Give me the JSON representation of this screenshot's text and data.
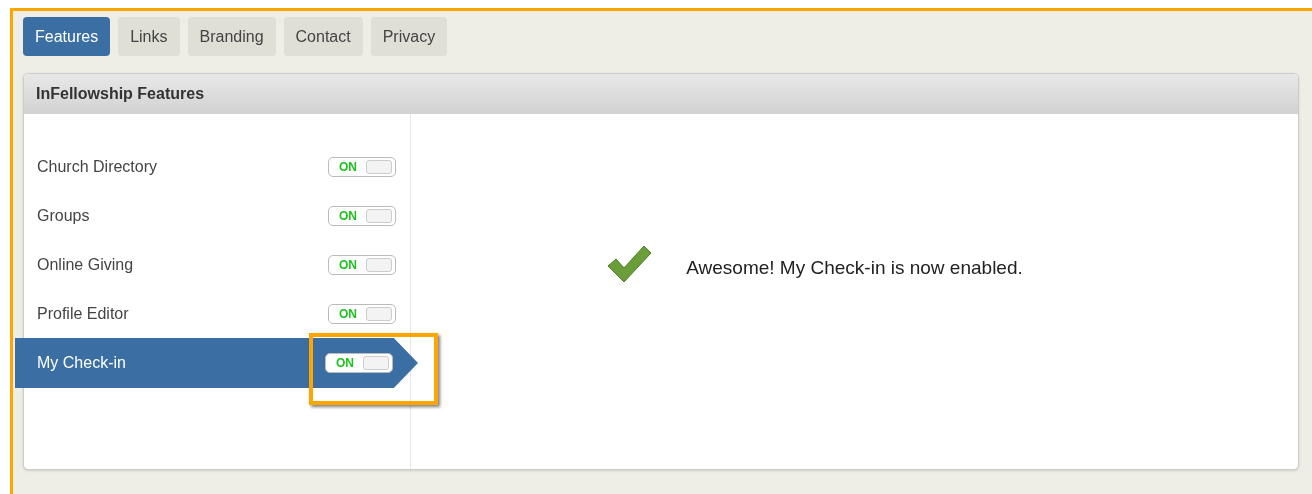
{
  "tabs": [
    {
      "label": "Features",
      "selected": true
    },
    {
      "label": "Links",
      "selected": false
    },
    {
      "label": "Branding",
      "selected": false
    },
    {
      "label": "Contact",
      "selected": false
    },
    {
      "label": "Privacy",
      "selected": false
    }
  ],
  "panel": {
    "title": "InFellowship Features"
  },
  "features": [
    {
      "name": "Church Directory",
      "on": true,
      "toggle_label": "ON",
      "selected": false,
      "highlighted": false
    },
    {
      "name": "Groups",
      "on": true,
      "toggle_label": "ON",
      "selected": false,
      "highlighted": false
    },
    {
      "name": "Online Giving",
      "on": true,
      "toggle_label": "ON",
      "selected": false,
      "highlighted": false
    },
    {
      "name": "Profile Editor",
      "on": true,
      "toggle_label": "ON",
      "selected": false,
      "highlighted": false
    },
    {
      "name": "My Check-in",
      "on": true,
      "toggle_label": "ON",
      "selected": true,
      "highlighted": true
    }
  ],
  "message": {
    "text": "Awesome! My Check-in is now enabled."
  }
}
